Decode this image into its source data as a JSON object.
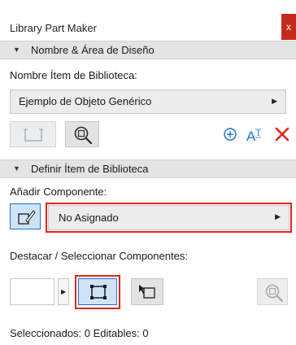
{
  "window": {
    "title": "Library Part Maker",
    "close_label": "x"
  },
  "section_design": {
    "label": "Nombre & Área de Diseño"
  },
  "name_field": {
    "label": "Nombre Ítem de Biblioteca:",
    "value": "Ejemplo de Objeto Genérico"
  },
  "section_define": {
    "label": "Definir Ítem de Biblioteca"
  },
  "component": {
    "label": "Añadir Componente:",
    "value": "No Asignado"
  },
  "highlight": {
    "label": "Destacar / Seleccionar Componentes:"
  },
  "status": {
    "text": "Seleccionados: 0 Editables: 0"
  },
  "colors": {
    "accent": "#1a73c9",
    "highlight_border": "#e2231a",
    "delete": "#e2231a",
    "section_bg": "#e4e4e4"
  },
  "icons": [
    "frame-icon",
    "zoom-fit-icon",
    "add-circle-icon",
    "text-size-icon",
    "delete-icon",
    "add-component-icon",
    "select-box-icon",
    "select-arrow-icon",
    "zoom-icon"
  ]
}
